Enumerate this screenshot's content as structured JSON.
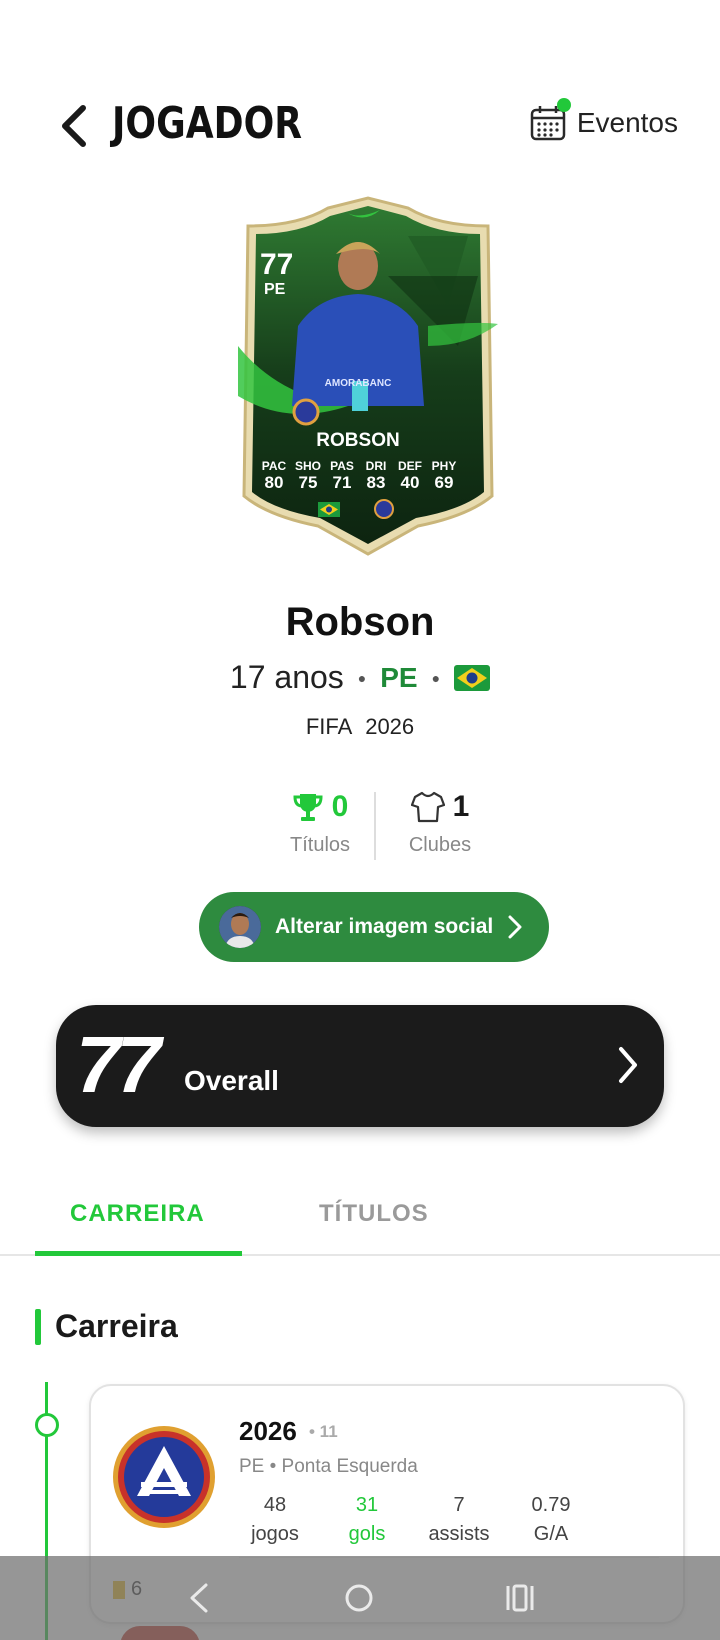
{
  "header": {
    "title": "JOGADOR",
    "events_label": "Eventos"
  },
  "player_card": {
    "rating": "77",
    "position": "PE",
    "name": "ROBSON",
    "sponsor": "AMORABANC",
    "stats": [
      {
        "label": "PAC",
        "value": "80"
      },
      {
        "label": "SHO",
        "value": "75"
      },
      {
        "label": "PAS",
        "value": "71"
      },
      {
        "label": "DRI",
        "value": "83"
      },
      {
        "label": "DEF",
        "value": "40"
      },
      {
        "label": "PHY",
        "value": "69"
      }
    ]
  },
  "player": {
    "name": "Robson",
    "age": "17 anos",
    "position": "PE",
    "game": "FIFA",
    "year": "2026"
  },
  "summary": {
    "titles_count": "0",
    "titles_label": "Títulos",
    "clubs_count": "1",
    "clubs_label": "Clubes"
  },
  "social_button": {
    "label": "Alterar imagem social"
  },
  "overall": {
    "value": "77",
    "label": "Overall"
  },
  "tabs": [
    {
      "label": "CARREIRA",
      "active": true
    },
    {
      "label": "TÍTULOS",
      "active": false
    }
  ],
  "section": {
    "title": "Carreira"
  },
  "career": [
    {
      "year": "2026",
      "shirt": "• 11",
      "position": "PE • Ponta Esquerda",
      "stats": [
        {
          "value": "48",
          "label": "jogos"
        },
        {
          "value": "31",
          "label": "gols"
        },
        {
          "value": "7",
          "label": "assists"
        },
        {
          "value": "0.79",
          "label": "G/A"
        }
      ],
      "yellow_cards": "6"
    }
  ],
  "colors": {
    "accent": "#22c83a",
    "button_green": "#2e8b3f",
    "overall_bg": "#1b1b1b"
  }
}
